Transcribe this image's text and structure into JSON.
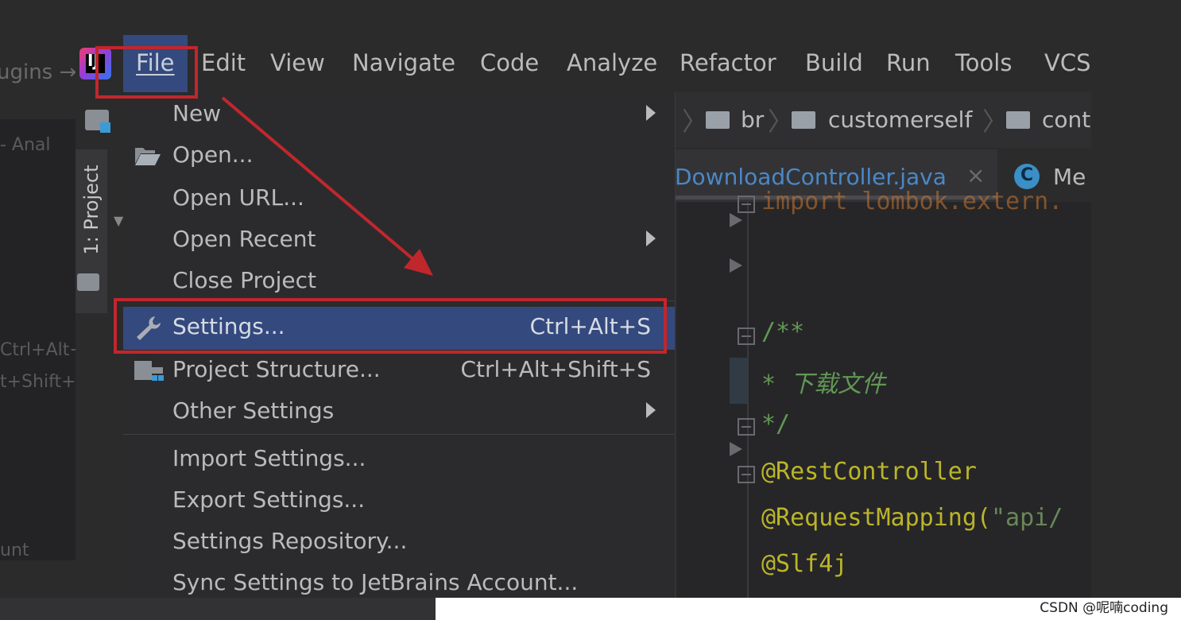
{
  "app": {
    "logo_text": "IJ",
    "background_crumb": "ugins →",
    "menubar": {
      "file": "File",
      "edit": "Edit",
      "view": "View",
      "navigate": "Navigate",
      "code": "Code",
      "analyze": "Analyze",
      "refactor": "Refactor",
      "build": "Build",
      "run": "Run",
      "tools": "Tools",
      "vcs": "VCS"
    },
    "left_ghosts": [
      "- Anal",
      "Ctrl+Alt+",
      "t+Shift+",
      "unt"
    ],
    "tool_window": {
      "project_tab": "1: Project"
    }
  },
  "file_menu": {
    "items": [
      {
        "label": "New",
        "shortcut": "",
        "submenu": true
      },
      {
        "label": "Open...",
        "shortcut": "",
        "submenu": false,
        "icon": "folder-open-icon"
      },
      {
        "label": "Open URL...",
        "shortcut": "",
        "submenu": false
      },
      {
        "label": "Open Recent",
        "shortcut": "",
        "submenu": true
      },
      {
        "label": "Close Project",
        "shortcut": "",
        "submenu": false
      },
      {
        "label": "Settings...",
        "shortcut": "Ctrl+Alt+S",
        "submenu": false,
        "icon": "wrench-icon",
        "selected": true
      },
      {
        "label": "Project Structure...",
        "shortcut": "Ctrl+Alt+Shift+S",
        "submenu": false,
        "icon": "project-structure-icon"
      },
      {
        "label": "Other Settings",
        "shortcut": "",
        "submenu": true
      },
      {
        "label": "Import Settings...",
        "shortcut": "",
        "submenu": false
      },
      {
        "label": "Export Settings...",
        "shortcut": "",
        "submenu": false
      },
      {
        "label": "Settings Repository...",
        "shortcut": "",
        "submenu": false
      },
      {
        "label": "Sync Settings to JetBrains Account...",
        "shortcut": "",
        "submenu": false
      }
    ]
  },
  "editor": {
    "breadcrumbs": [
      "br",
      "customerself",
      "cont"
    ],
    "tabs": [
      {
        "label": "DownloadController.java",
        "active": true
      },
      {
        "label": "Me",
        "active": false,
        "icon_letter": "C"
      }
    ],
    "code_lines": [
      {
        "text": "import lombok.extern.",
        "type": "kw"
      },
      {
        "text": "/**",
        "type": "cmt"
      },
      {
        "text": " *  下载文件",
        "type": "cmt"
      },
      {
        "text": " */",
        "type": "cmt"
      },
      {
        "text": "@RestController",
        "type": "ann"
      },
      {
        "text": "@RequestMapping(",
        "type": "ann",
        "suffix": "\"api/"
      },
      {
        "text": "@Slf4j",
        "type": "ann"
      }
    ]
  },
  "watermark": "CSDN @呢喃coding",
  "colors": {
    "highlight": "#34497d",
    "annotation_red": "#c0272d",
    "background": "#2b2b2c"
  }
}
